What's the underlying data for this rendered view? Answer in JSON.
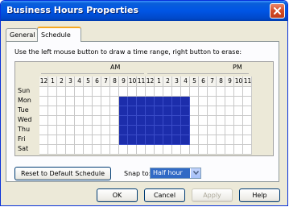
{
  "window": {
    "title": "Business Hours Properties",
    "close_icon": "close-icon"
  },
  "tabs": [
    {
      "label": "General",
      "active": false
    },
    {
      "label": "Schedule",
      "active": true
    }
  ],
  "schedule": {
    "instructions": "Use the left mouse button to draw a time range, right button to erase:",
    "am_label": "AM",
    "pm_label": "PM",
    "hours": [
      "12",
      "1",
      "2",
      "3",
      "4",
      "5",
      "6",
      "7",
      "8",
      "9",
      "10",
      "11",
      "12",
      "1",
      "2",
      "3",
      "4",
      "5",
      "6",
      "7",
      "8",
      "9",
      "10",
      "11"
    ],
    "days": [
      "Sun",
      "Mon",
      "Tue",
      "Wed",
      "Thu",
      "Fri",
      "Sat"
    ],
    "selected_color": "#1c2dab",
    "selected_days": [
      "Mon",
      "Tue",
      "Wed",
      "Thu",
      "Fri"
    ],
    "selected_hours": [
      "9",
      "10",
      "11",
      "12",
      "1",
      "2",
      "3",
      "4"
    ]
  },
  "controls": {
    "reset_label": "Reset to Default Schedule",
    "snap_label": "Snap to:",
    "snap_value": "Half hour"
  },
  "buttons": {
    "ok": "OK",
    "cancel": "Cancel",
    "apply": "Apply",
    "help": "Help"
  }
}
